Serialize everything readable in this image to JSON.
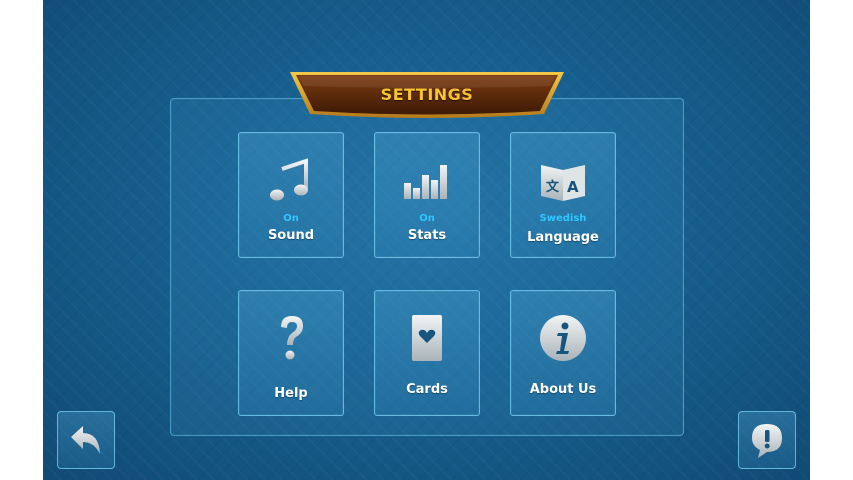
{
  "header": {
    "title": "SETTINGS"
  },
  "colors": {
    "accent_status": "#2fc7ff",
    "title_gold": "#f7c430",
    "banner_brown": "#5a2a0c"
  },
  "tiles": [
    {
      "id": "sound",
      "icon": "music-note-icon",
      "status": "On",
      "label": "Sound"
    },
    {
      "id": "stats",
      "icon": "bar-chart-icon",
      "status": "On",
      "label": "Stats"
    },
    {
      "id": "language",
      "icon": "language-icon",
      "status": "Swedish",
      "label": "Language"
    },
    {
      "id": "help",
      "icon": "question-mark-icon",
      "status": "",
      "label": "Help"
    },
    {
      "id": "cards",
      "icon": "card-heart-icon",
      "status": "",
      "label": "Cards"
    },
    {
      "id": "about",
      "icon": "info-icon",
      "status": "",
      "label": "About Us"
    }
  ],
  "footer": {
    "back_icon": "back-arrow-icon",
    "feedback_icon": "feedback-bubble-icon"
  }
}
